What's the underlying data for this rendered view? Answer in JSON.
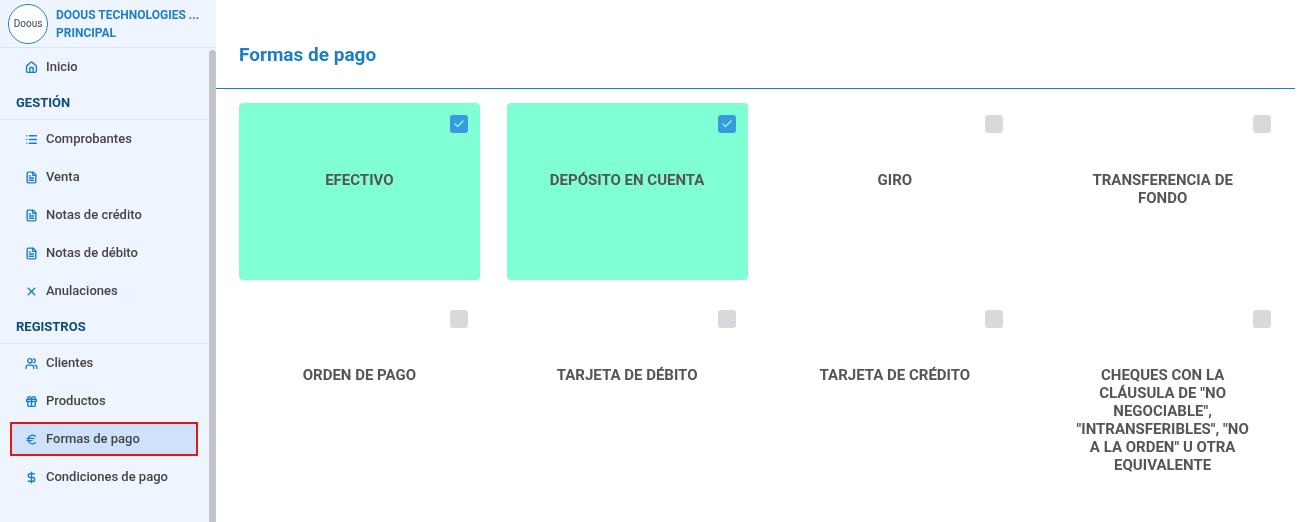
{
  "brand": {
    "logo": "Doous",
    "name": "DOOUS TECHNOLOGIES ...",
    "branch": "PRINCIPAL"
  },
  "sidebar": [
    {
      "kind": "item",
      "label": "Inicio",
      "selected": false
    },
    {
      "kind": "section",
      "label": "GESTIÓN"
    },
    {
      "kind": "item",
      "label": "Comprobantes",
      "selected": false
    },
    {
      "kind": "item",
      "label": "Venta",
      "selected": false
    },
    {
      "kind": "item",
      "label": "Notas de crédito",
      "selected": false
    },
    {
      "kind": "item",
      "label": "Notas de débito",
      "selected": false
    },
    {
      "kind": "item",
      "label": "Anulaciones",
      "selected": false
    },
    {
      "kind": "section",
      "label": "REGISTROS"
    },
    {
      "kind": "item",
      "label": "Clientes",
      "selected": false
    },
    {
      "kind": "item",
      "label": "Productos",
      "selected": false
    },
    {
      "kind": "item",
      "label": "Formas de pago",
      "selected": true
    },
    {
      "kind": "item",
      "label": "Condiciones de pago",
      "selected": false
    }
  ],
  "page_title": "Formas de pago",
  "payment_methods": [
    {
      "label": "EFECTIVO",
      "checked": true
    },
    {
      "label": "DEPÓSITO EN CUENTA",
      "checked": true
    },
    {
      "label": "GIRO",
      "checked": false
    },
    {
      "label": "TRANSFERENCIA DE FONDO",
      "checked": false
    },
    {
      "label": "ORDEN DE PAGO",
      "checked": false
    },
    {
      "label": "TARJETA DE DÉBITO",
      "checked": false
    },
    {
      "label": "TARJETA DE CRÉDITO",
      "checked": false
    },
    {
      "label": "CHEQUES CON LA CLÁUSULA DE \"NO NEGOCIABLE\", \"INTRANSFERIBLES\", \"NO A LA ORDEN\" U OTRA EQUIVALENTE",
      "checked": false
    }
  ]
}
